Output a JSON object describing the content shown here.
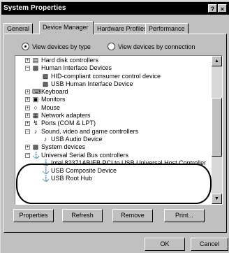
{
  "window": {
    "title": "System Properties",
    "help_label": "?",
    "close_label": "×"
  },
  "tabs": [
    {
      "label": "General"
    },
    {
      "label": "Device Manager"
    },
    {
      "label": "Hardware Profiles"
    },
    {
      "label": "Performance"
    }
  ],
  "view_options": {
    "by_type": "View devices by type",
    "by_connection": "View devices by connection",
    "selected": "by_type"
  },
  "tree": [
    {
      "label": "Hard disk controllers",
      "icon": "disk-controller-icon"
    },
    {
      "label": "Human Interface Devices",
      "icon": "hid-icon"
    },
    {
      "label": "HID-compliant consumer control device",
      "icon": "hid-device-icon"
    },
    {
      "label": "USB Human Interface Device",
      "icon": "hid-device-icon"
    },
    {
      "label": "Keyboard",
      "icon": "keyboard-icon"
    },
    {
      "label": "Monitors",
      "icon": "monitor-icon"
    },
    {
      "label": "Mouse",
      "icon": "mouse-icon"
    },
    {
      "label": "Network adapters",
      "icon": "network-adapter-icon"
    },
    {
      "label": "Ports (COM & LPT)",
      "icon": "port-icon"
    },
    {
      "label": "Sound, video and game controllers",
      "icon": "sound-icon"
    },
    {
      "label": "USB Audio Device",
      "icon": "audio-device-icon"
    },
    {
      "label": "System devices",
      "icon": "system-device-icon"
    },
    {
      "label": "Universal Serial Bus controllers",
      "icon": "usb-icon"
    },
    {
      "label": "Intel 82371AB/EB PCI to USB Universal Host Controller",
      "icon": "usb-icon"
    },
    {
      "label": "USB Composite Device",
      "icon": "usb-icon"
    },
    {
      "label": "USB Root Hub",
      "icon": "usb-icon"
    }
  ],
  "buttons": {
    "properties": "Properties",
    "refresh": "Refresh",
    "remove": "Remove",
    "print": "Print...",
    "ok": "OK",
    "cancel": "Cancel"
  }
}
